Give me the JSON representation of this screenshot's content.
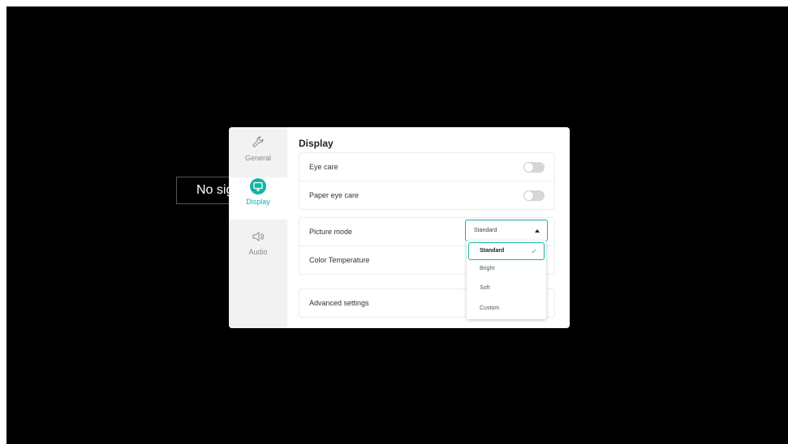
{
  "background_text": "No signal",
  "sidebar": {
    "items": [
      {
        "label": "General",
        "icon": "wrench-icon",
        "active": false
      },
      {
        "label": "Display",
        "icon": "monitor-icon",
        "active": true
      },
      {
        "label": "Audio",
        "icon": "speaker-icon",
        "active": false
      }
    ]
  },
  "main": {
    "title": "Display",
    "eye_care": {
      "label": "Eye care",
      "enabled": false
    },
    "paper_eye_care": {
      "label": "Paper eye care",
      "enabled": false
    },
    "picture_mode": {
      "label": "Picture mode",
      "value": "Standard"
    },
    "color_temperature": {
      "label": "Color Temperature"
    },
    "advanced_settings": {
      "label": "Advanced settings"
    }
  },
  "dropdown": {
    "options": [
      "Standard",
      "Bright",
      "Soft",
      "Custom"
    ],
    "selected": "Standard"
  },
  "colors": {
    "accent": "#12b5a4",
    "screen": "#000000"
  }
}
